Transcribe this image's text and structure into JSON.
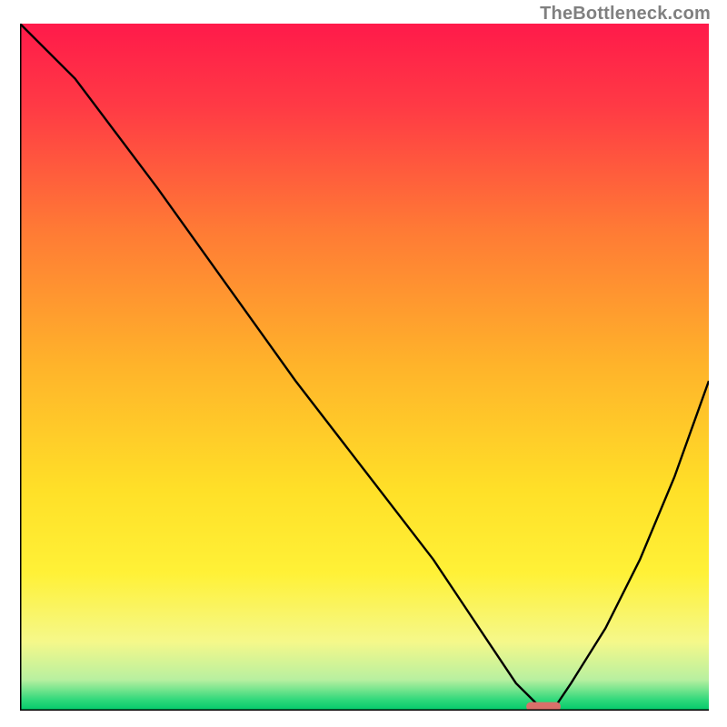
{
  "watermark": "TheBottleneck.com",
  "chart_data": {
    "type": "line",
    "title": "",
    "xlabel": "",
    "ylabel": "",
    "xlim": [
      0,
      100
    ],
    "ylim": [
      0,
      100
    ],
    "axes_visible": false,
    "background_gradient": {
      "stops": [
        {
          "offset": 0.0,
          "color": "#ff1a4a"
        },
        {
          "offset": 0.12,
          "color": "#ff3a45"
        },
        {
          "offset": 0.3,
          "color": "#ff7a35"
        },
        {
          "offset": 0.5,
          "color": "#ffb42a"
        },
        {
          "offset": 0.68,
          "color": "#ffe028"
        },
        {
          "offset": 0.8,
          "color": "#fff137"
        },
        {
          "offset": 0.9,
          "color": "#f5f88a"
        },
        {
          "offset": 0.955,
          "color": "#b8f0a0"
        },
        {
          "offset": 0.985,
          "color": "#2dd87a"
        },
        {
          "offset": 1.0,
          "color": "#00c96a"
        }
      ]
    },
    "series": [
      {
        "name": "bottleneck-curve",
        "x": [
          0,
          8,
          20,
          30,
          40,
          50,
          60,
          68,
          72,
          75,
          78,
          80,
          85,
          90,
          95,
          100
        ],
        "y": [
          100,
          92,
          76,
          62,
          48,
          35,
          22,
          10,
          4,
          1,
          1,
          4,
          12,
          22,
          34,
          48
        ]
      }
    ],
    "marker": {
      "name": "optimal-point",
      "x": 76,
      "y": 0.6,
      "width_pct": 5,
      "height_pct": 1.3,
      "color": "#d9706a"
    }
  }
}
